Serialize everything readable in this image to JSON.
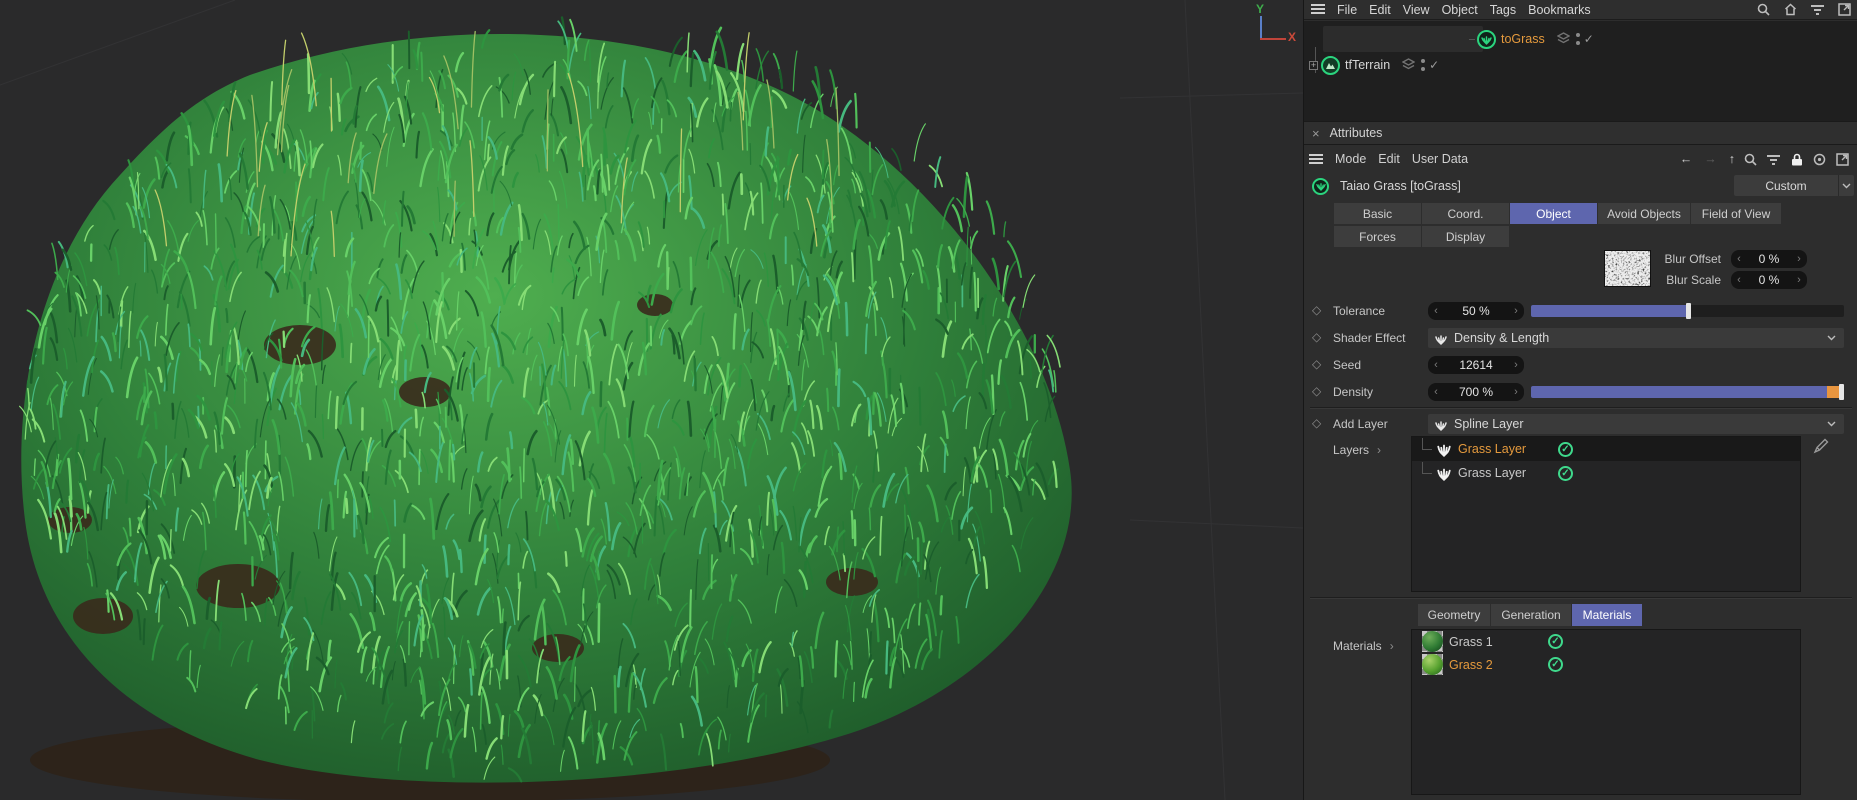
{
  "menu": {
    "items": [
      "File",
      "Edit",
      "View",
      "Object",
      "Tags",
      "Bookmarks"
    ]
  },
  "objects": [
    {
      "name": "toGrass",
      "selected": true
    },
    {
      "name": "tfTerrain",
      "selected": false
    }
  ],
  "viewport": {
    "axis_x": "X",
    "axis_y": "Y"
  },
  "attributes": {
    "title": "Attributes",
    "toolbar": {
      "items": [
        "Mode",
        "Edit",
        "User Data"
      ]
    },
    "object_title": "Taiao Grass [toGrass]",
    "preset": "Custom",
    "tabs": [
      "Basic",
      "Coord.",
      "Object",
      "Avoid Objects",
      "Field of View",
      "Forces",
      "Display"
    ],
    "active_tab": "Object",
    "params": {
      "blur_offset": {
        "label": "Blur Offset",
        "value": "0 %"
      },
      "blur_scale": {
        "label": "Blur Scale",
        "value": "0 %"
      },
      "tolerance": {
        "label": "Tolerance",
        "value": "50 %",
        "slider_pct": 50
      },
      "shader_effect": {
        "label": "Shader Effect",
        "value": "Density & Length"
      },
      "seed": {
        "label": "Seed",
        "value": "12614"
      },
      "density": {
        "label": "Density",
        "value": "700 %",
        "slider_pct": 100
      }
    },
    "add_layer": {
      "label": "Add Layer",
      "value": "Spline Layer"
    },
    "layers": {
      "label": "Layers",
      "items": [
        {
          "name": "Grass Layer",
          "selected": true,
          "enabled": true
        },
        {
          "name": "Grass Layer",
          "selected": false,
          "enabled": true
        }
      ]
    },
    "materials": {
      "tabs": [
        "Geometry",
        "Generation",
        "Materials"
      ],
      "active_tab": "Materials",
      "label": "Materials",
      "items": [
        {
          "name": "Grass 1",
          "selected": false,
          "enabled": true
        },
        {
          "name": "Grass 2",
          "selected": true,
          "enabled": true
        }
      ]
    }
  },
  "icons": {
    "close": "×",
    "chevron_left": "‹",
    "chevron_right": "›",
    "check": "✓",
    "back_arrow": "←",
    "forward_arrow": "→",
    "up_arrow": "↑",
    "plus": "+",
    "diamond": "◇"
  },
  "colors": {
    "accent_blue": "#5e66ae",
    "accent_orange": "#e59a3d",
    "check_green": "#3fd98c",
    "icon_green": "#2bd47e",
    "slider_orange": "#e8953f",
    "panel_bg": "#2d2d2d"
  }
}
